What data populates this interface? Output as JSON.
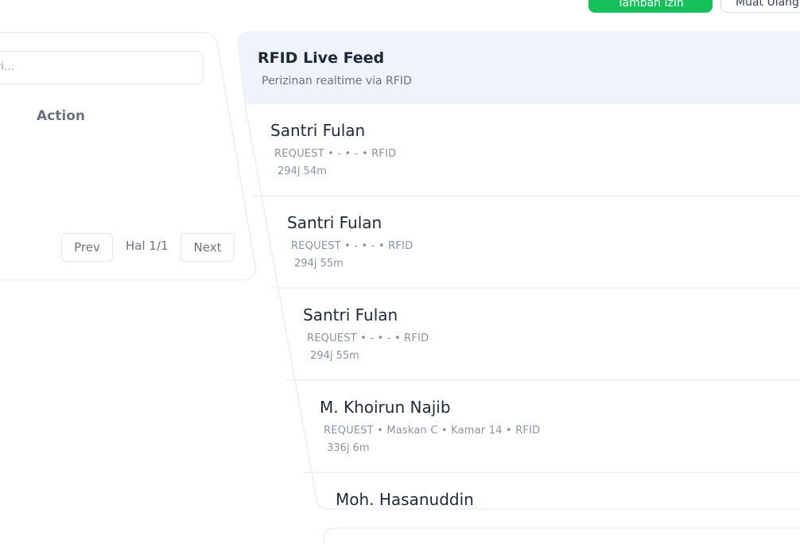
{
  "toolbar": {
    "add_label": "Tambah Izin",
    "secondary_label": "Muat Ulang"
  },
  "list_panel": {
    "search_placeholder": "Cari...",
    "column_action": "Action",
    "pager": {
      "prev": "Prev",
      "page_text": "Hal 1/1",
      "next": "Next"
    }
  },
  "feed": {
    "title": "RFID Live Feed",
    "subtitle": "Perizinan realtime via RFID",
    "items": [
      {
        "name": "Santri Fulan",
        "meta": "REQUEST • - • - • RFID",
        "time": "294j 54m"
      },
      {
        "name": "Santri Fulan",
        "meta": "REQUEST • - • - • RFID",
        "time": "294j 55m"
      },
      {
        "name": "Santri Fulan",
        "meta": "REQUEST • - • - • RFID",
        "time": "294j 55m"
      },
      {
        "name": "M. Khoirun Najib",
        "meta": "REQUEST • Maskan C • Kamar 14 • RFID",
        "time": "336j 6m"
      },
      {
        "name": "Moh. Hasanuddin",
        "meta": "",
        "time": ""
      }
    ]
  },
  "colors": {
    "accent_green": "#16c05a",
    "feed_header_bg": "#eef3fd",
    "border": "#e5e7eb"
  }
}
